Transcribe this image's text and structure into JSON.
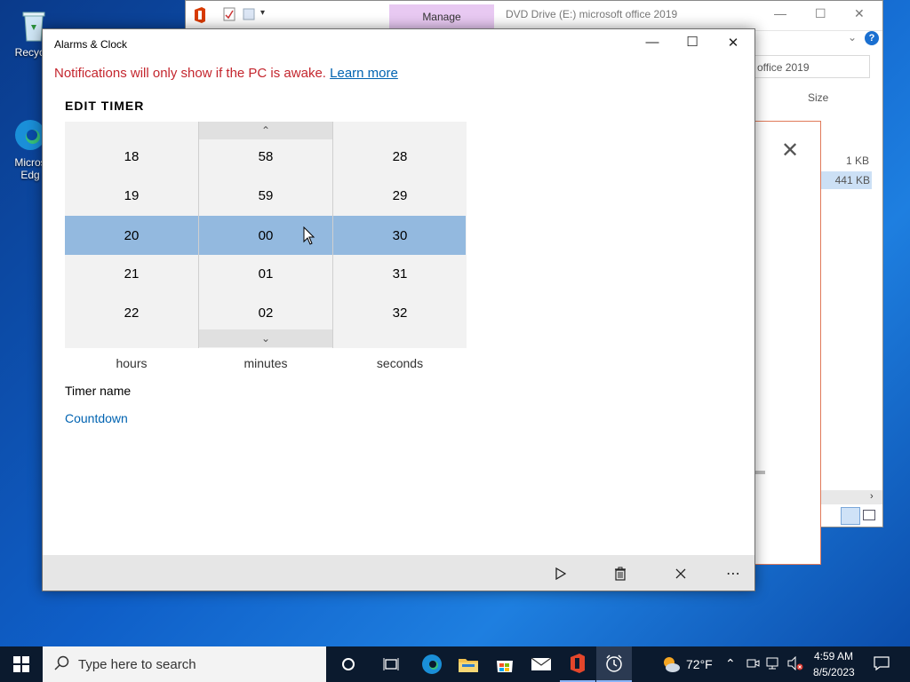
{
  "desktop": {
    "icons": [
      {
        "label": "Recycle"
      },
      {
        "label": "Micros\nEdg"
      }
    ]
  },
  "explorer": {
    "tab_manage": "Manage",
    "title": "DVD Drive (E:) microsoft office 2019",
    "address": "office 2019",
    "column_size": "Size",
    "sizes": [
      "1 KB",
      "441 KB"
    ]
  },
  "alarms": {
    "window_title": "Alarms & Clock",
    "notice_text": "Notifications will only show if the PC is awake.",
    "notice_link": "Learn more",
    "heading": "EDIT TIMER",
    "hours": {
      "above": [
        "18",
        "19"
      ],
      "selected": "20",
      "below": [
        "21",
        "22"
      ],
      "label": "hours"
    },
    "minutes": {
      "above": [
        "58",
        "59"
      ],
      "selected": "00",
      "below": [
        "01",
        "02"
      ],
      "label": "minutes"
    },
    "seconds": {
      "above": [
        "28",
        "29"
      ],
      "selected": "30",
      "below": [
        "31",
        "32"
      ],
      "label": "seconds"
    },
    "timer_name_label": "Timer name",
    "timer_name_value": "Countdown"
  },
  "taskbar": {
    "search_placeholder": "Type here to search",
    "weather_temp": "72°F",
    "time": "4:59 AM",
    "date": "8/5/2023"
  },
  "colors": {
    "accent": "#0063b1",
    "selection": "#93b9df",
    "notice": "#c4262e"
  }
}
